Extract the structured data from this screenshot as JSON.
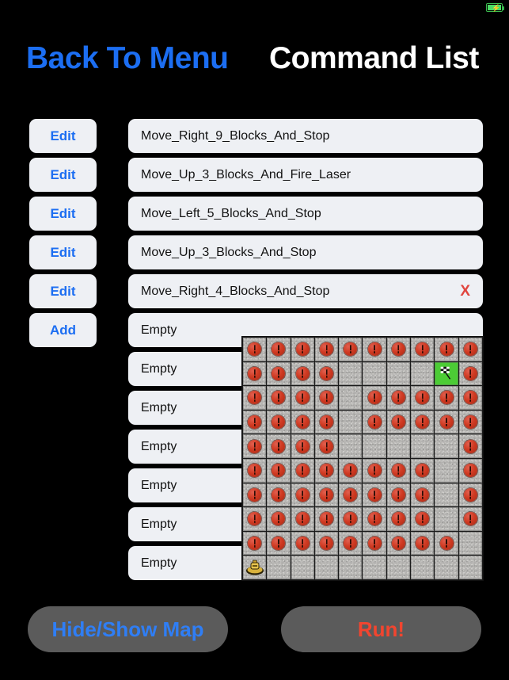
{
  "statusbar": {
    "battery_icon": "battery-charging-icon",
    "bolt": "⚡"
  },
  "header": {
    "back_label": "Back To Menu",
    "title": "Command List"
  },
  "side_buttons": [
    {
      "label": "Edit",
      "name": "edit-button-1"
    },
    {
      "label": "Edit",
      "name": "edit-button-2"
    },
    {
      "label": "Edit",
      "name": "edit-button-3"
    },
    {
      "label": "Edit",
      "name": "edit-button-4"
    },
    {
      "label": "Edit",
      "name": "edit-button-5"
    },
    {
      "label": "Add",
      "name": "add-button"
    }
  ],
  "commands": [
    {
      "text": "Move_Right_9_Blocks_And_Stop",
      "delete": ""
    },
    {
      "text": "Move_Up_3_Blocks_And_Fire_Laser",
      "delete": ""
    },
    {
      "text": "Move_Left_5_Blocks_And_Stop",
      "delete": ""
    },
    {
      "text": "Move_Up_3_Blocks_And_Stop",
      "delete": ""
    },
    {
      "text": "Move_Right_4_Blocks_And_Stop",
      "delete": "X"
    },
    {
      "text": "Empty",
      "delete": ""
    },
    {
      "text": "Empty",
      "delete": ""
    },
    {
      "text": "Empty",
      "delete": ""
    },
    {
      "text": "Empty",
      "delete": ""
    },
    {
      "text": "Empty",
      "delete": ""
    },
    {
      "text": "Empty",
      "delete": ""
    },
    {
      "text": "Empty",
      "delete": ""
    }
  ],
  "bottom": {
    "hide_show_label": "Hide/Show Map",
    "run_label": "Run!"
  },
  "colors": {
    "accent_blue": "#1c6ef2",
    "run_red": "#f2452f",
    "delete_red": "#e0453e",
    "row_bg": "#eef0f4",
    "button_gray": "#5b5b5b",
    "goal_green": "#4ccc35",
    "mine_red": "#d03a22",
    "robot_gold": "#d9b23c",
    "background": "#000000"
  },
  "map": {
    "rows": 10,
    "cols": 10,
    "legend": {
      "mine": "hazard-mine",
      "empty": "empty-floor",
      "goal": "goal-flag",
      "robot": "player-robot"
    },
    "grid": [
      [
        "mine",
        "mine",
        "mine",
        "mine",
        "mine",
        "mine",
        "mine",
        "mine",
        "mine",
        "mine"
      ],
      [
        "mine",
        "mine",
        "mine",
        "mine",
        "empty",
        "empty",
        "empty",
        "empty",
        "goal",
        "mine"
      ],
      [
        "mine",
        "mine",
        "mine",
        "mine",
        "empty",
        "mine",
        "mine",
        "mine",
        "mine",
        "mine"
      ],
      [
        "mine",
        "mine",
        "mine",
        "mine",
        "empty",
        "mine",
        "mine",
        "mine",
        "mine",
        "mine"
      ],
      [
        "mine",
        "mine",
        "mine",
        "mine",
        "empty",
        "empty",
        "empty",
        "empty",
        "empty",
        "mine"
      ],
      [
        "mine",
        "mine",
        "mine",
        "mine",
        "mine",
        "mine",
        "mine",
        "mine",
        "empty",
        "mine"
      ],
      [
        "mine",
        "mine",
        "mine",
        "mine",
        "mine",
        "mine",
        "mine",
        "mine",
        "empty",
        "mine"
      ],
      [
        "mine",
        "mine",
        "mine",
        "mine",
        "mine",
        "mine",
        "mine",
        "mine",
        "empty",
        "mine"
      ],
      [
        "mine",
        "mine",
        "mine",
        "mine",
        "mine",
        "mine",
        "mine",
        "mine",
        "mine",
        "empty"
      ],
      [
        "robot",
        "empty",
        "empty",
        "empty",
        "empty",
        "empty",
        "empty",
        "empty",
        "empty",
        "empty"
      ]
    ]
  }
}
